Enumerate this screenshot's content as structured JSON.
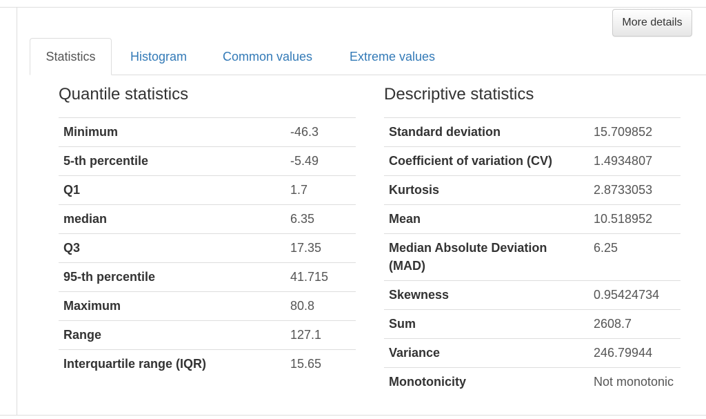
{
  "toolbar": {
    "more_details_label": "More details"
  },
  "tabs": [
    {
      "label": "Statistics",
      "active": true
    },
    {
      "label": "Histogram",
      "active": false
    },
    {
      "label": "Common values",
      "active": false
    },
    {
      "label": "Extreme values",
      "active": false
    }
  ],
  "quantile": {
    "title": "Quantile statistics",
    "rows": [
      {
        "label": "Minimum",
        "value": "-46.3"
      },
      {
        "label": "5-th percentile",
        "value": "-5.49"
      },
      {
        "label": "Q1",
        "value": "1.7"
      },
      {
        "label": "median",
        "value": "6.35"
      },
      {
        "label": "Q3",
        "value": "17.35"
      },
      {
        "label": "95-th percentile",
        "value": "41.715"
      },
      {
        "label": "Maximum",
        "value": "80.8"
      },
      {
        "label": "Range",
        "value": "127.1"
      },
      {
        "label": "Interquartile range (IQR)",
        "value": "15.65"
      }
    ]
  },
  "descriptive": {
    "title": "Descriptive statistics",
    "rows": [
      {
        "label": "Standard deviation",
        "value": "15.709852"
      },
      {
        "label": "Coefficient of variation (CV)",
        "value": "1.4934807"
      },
      {
        "label": "Kurtosis",
        "value": "2.8733053"
      },
      {
        "label": "Mean",
        "value": "10.518952"
      },
      {
        "label": "Median Absolute Deviation (MAD)",
        "value": "6.25"
      },
      {
        "label": "Skewness",
        "value": "0.95424734"
      },
      {
        "label": "Sum",
        "value": "2608.7"
      },
      {
        "label": "Variance",
        "value": "246.79944"
      },
      {
        "label": "Monotonicity",
        "value": "Not monotonic"
      }
    ]
  },
  "colors": {
    "link": "#337ab7",
    "border": "#dddddd",
    "text": "#333333"
  }
}
